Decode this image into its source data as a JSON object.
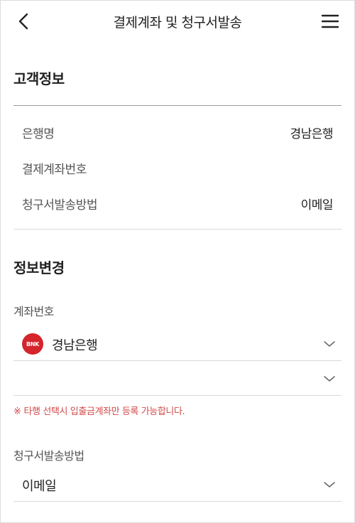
{
  "header": {
    "title": "결제계좌 및 청구서발송",
    "back_icon": "chevron-left-icon",
    "menu_icon": "hamburger-menu-icon"
  },
  "customer_info": {
    "title": "고객정보",
    "rows": [
      {
        "label": "은행명",
        "value": "경남은행"
      },
      {
        "label": "결제계좌번호",
        "value": ""
      },
      {
        "label": "청구서발송방법",
        "value": "이메일"
      }
    ]
  },
  "change_info": {
    "title": "정보변경",
    "account_label": "계좌번호",
    "bank_select": {
      "value": "경남은행",
      "logo_text": "BNK",
      "logo_color": "#d4242c"
    },
    "account_select": {
      "value": ""
    },
    "notice_mark": "※",
    "notice": "타행 선택시 입출금계좌만 등록 가능합니다.",
    "billing_label": "청구서발송방법",
    "billing_select": {
      "value": "이메일"
    }
  },
  "colors": {
    "notice": "#d24a4a",
    "bank_logo": "#d4242c"
  }
}
